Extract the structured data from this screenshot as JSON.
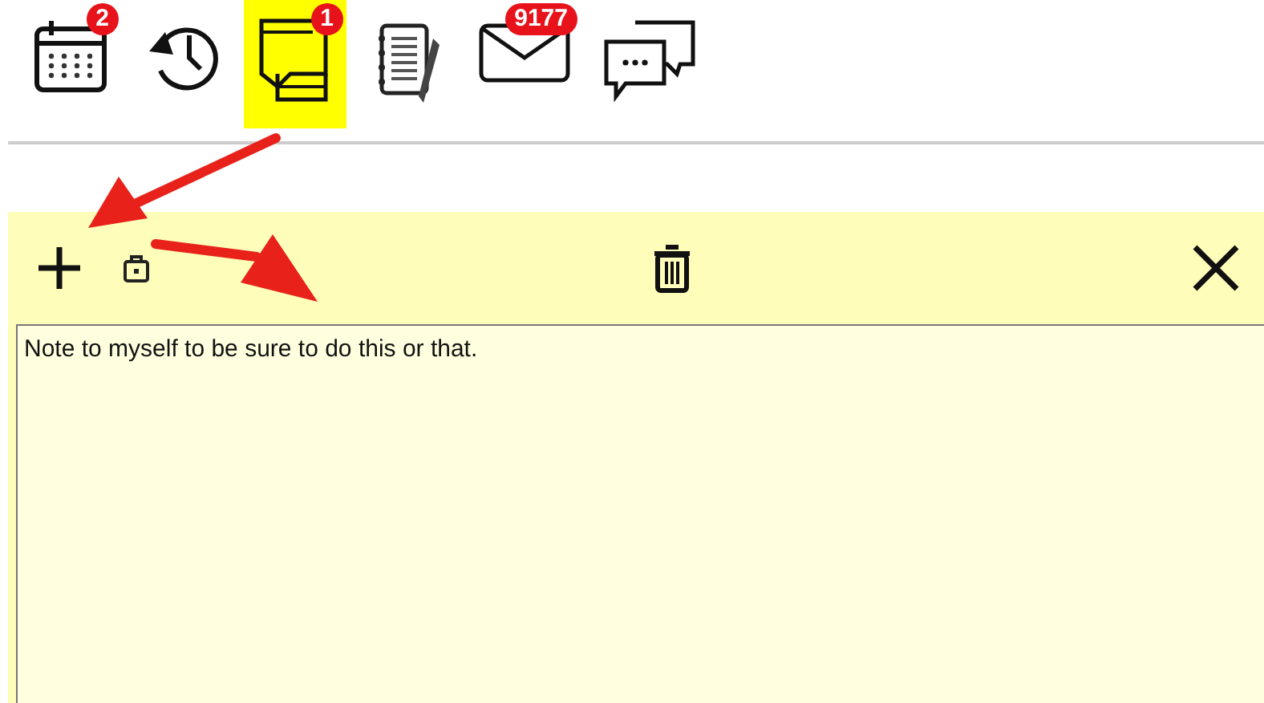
{
  "toolbar": {
    "items": [
      {
        "kind": "calendar",
        "badge": "2",
        "selected": false
      },
      {
        "kind": "history",
        "selected": false
      },
      {
        "kind": "notes",
        "badge": "1",
        "selected": true
      },
      {
        "kind": "journal",
        "selected": false
      },
      {
        "kind": "mail",
        "badge": "9177",
        "selected": false
      },
      {
        "kind": "chat",
        "selected": false
      }
    ]
  },
  "note": {
    "text": "Note to myself to be sure to do this or that."
  }
}
